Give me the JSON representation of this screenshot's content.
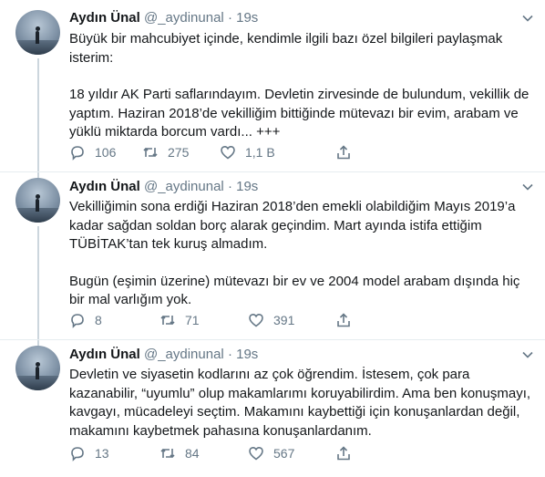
{
  "tweets": [
    {
      "name": "Aydın Ünal",
      "handle": "@_aydinunal",
      "dot": "·",
      "time": "19s",
      "paragraphs": [
        "Büyük bir mahcubiyet içinde, kendimle ilgili bazı özel bilgileri paylaşmak isterim:",
        "18 yıldır AK Parti saflarındayım. Devletin zirvesinde de bulundum, vekillik de yaptım. Haziran 2018’de vekilliğim bittiğinde mütevazı bir evim, arabam ve yüklü miktarda borcum vardı... +++"
      ],
      "replies": "106",
      "retweets": "275",
      "likes": "1,1 B"
    },
    {
      "name": "Aydın Ünal",
      "handle": "@_aydinunal",
      "dot": "·",
      "time": "19s",
      "paragraphs": [
        "Vekilliğimin sona erdiği Haziran 2018’den emekli olabildiğim Mayıs 2019’a kadar sağdan soldan borç alarak geçindim. Mart ayında istifa ettiğim TÜBİTAK’tan tek kuruş almadım.",
        "Bugün (eşimin üzerine) mütevazı bir ev ve 2004 model arabam dışında hiç bir mal varlığım yok."
      ],
      "replies": "8",
      "retweets": "71",
      "likes": "391"
    },
    {
      "name": "Aydın Ünal",
      "handle": "@_aydinunal",
      "dot": "·",
      "time": "19s",
      "paragraphs": [
        "Devletin ve siyasetin kodlarını az çok öğrendim. İstesem, çok para kazanabilir, “uyumlu” olup makamlarımı koruyabilirdim. Ama ben konuşmayı, kavgayı, mücadeleyi seçtim. Makamını kaybettiği için konuşanlardan değil, makamını kaybetmek pahasına konuşanlardanım."
      ],
      "replies": "13",
      "retweets": "84",
      "likes": "567"
    }
  ],
  "icons": {
    "reply": "reply-icon",
    "retweet": "retweet-icon",
    "like": "heart-icon",
    "share": "share-icon",
    "menu": "chevron-down-icon"
  },
  "colors": {
    "text": "#14171a",
    "secondary": "#657786",
    "separator": "#e6ecf0",
    "thread_line": "#ccd6dd"
  }
}
